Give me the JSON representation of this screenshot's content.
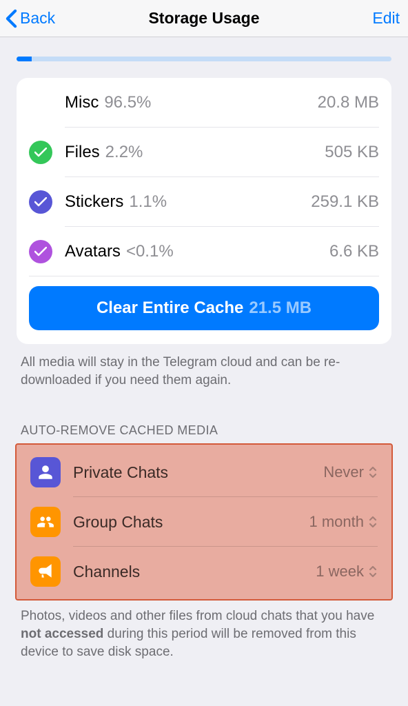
{
  "nav": {
    "back_label": "Back",
    "title": "Storage Usage",
    "edit_label": "Edit"
  },
  "cache_items": [
    {
      "label": "Misc",
      "percent": "96.5%",
      "size": "20.8 MB",
      "color": "#ff9500"
    },
    {
      "label": "Files",
      "percent": "2.2%",
      "size": "505 KB",
      "color": "#34c759"
    },
    {
      "label": "Stickers",
      "percent": "1.1%",
      "size": "259.1 KB",
      "color": "#5856d6"
    },
    {
      "label": "Avatars",
      "percent": "<0.1%",
      "size": "6.6 KB",
      "color": "#af52de"
    }
  ],
  "clear_button": {
    "label": "Clear Entire Cache",
    "size": "21.5 MB"
  },
  "cache_footer": "All media will stay in the Telegram cloud and can be re-downloaded if you need them again.",
  "auto_remove": {
    "header": "AUTO-REMOVE CACHED MEDIA",
    "items": [
      {
        "label": "Private Chats",
        "value": "Never",
        "icon": "person",
        "color": "#5856d6"
      },
      {
        "label": "Group Chats",
        "value": "1 month",
        "icon": "group",
        "color": "#ff9500"
      },
      {
        "label": "Channels",
        "value": "1 week",
        "icon": "megaphone",
        "color": "#ff9500"
      }
    ],
    "footer_pre": "Photos, videos and other files from cloud chats that you have ",
    "footer_bold": "not accessed",
    "footer_post": " during this period will be removed from this device to save disk space."
  }
}
